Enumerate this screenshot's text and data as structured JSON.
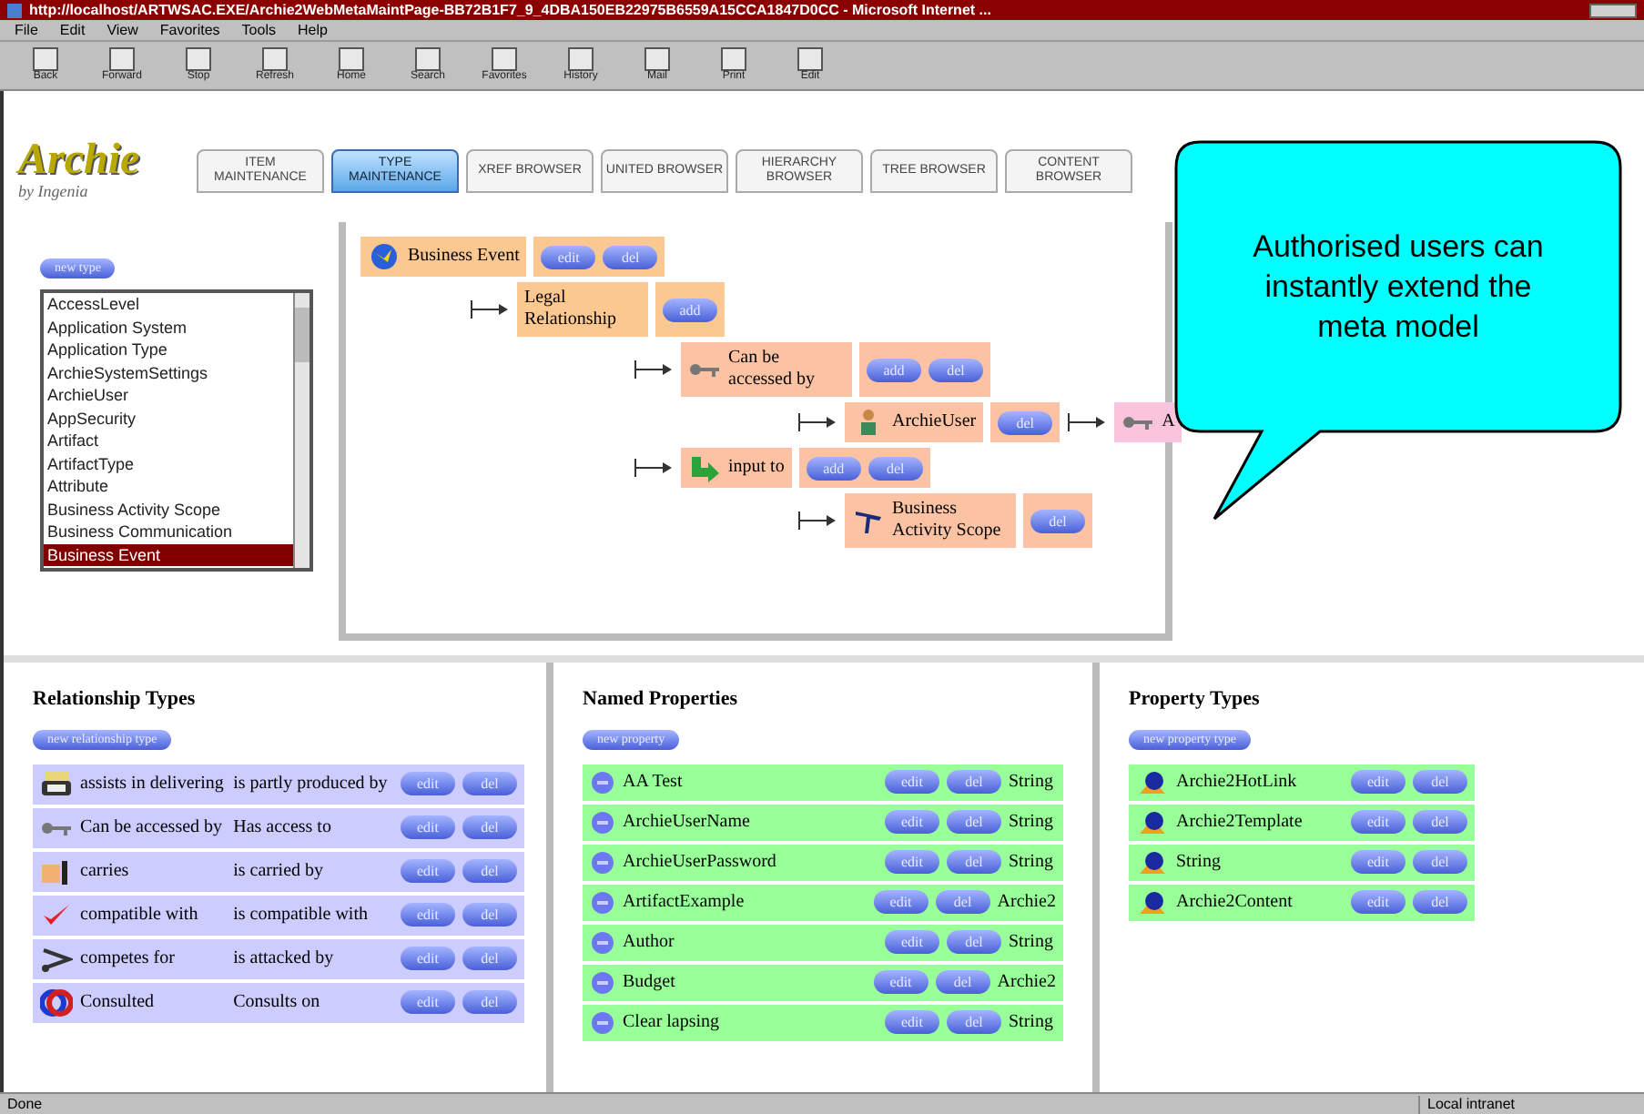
{
  "window": {
    "title": "http://localhost/ARTWSAC.EXE/Archie2WebMetaMaintPage-BB72B1F7_9_4DBA150EB22975B6559A15CCA1847D0CC - Microsoft Internet ..."
  },
  "menu": [
    "File",
    "Edit",
    "View",
    "Favorites",
    "Tools",
    "Help"
  ],
  "toolbar": [
    "Back",
    "Forward",
    "Stop",
    "Refresh",
    "Home",
    "Search",
    "Favorites",
    "History",
    "Mail",
    "Print",
    "Edit"
  ],
  "logo": {
    "name": "Archie",
    "tagline": "by Ingenia"
  },
  "tabs": [
    {
      "label": "ITEM MAINTENANCE",
      "selected": false
    },
    {
      "label": "TYPE MAINTENANCE",
      "selected": true
    },
    {
      "label": "XREF BROWSER",
      "selected": false
    },
    {
      "label": "UNITED BROWSER",
      "selected": false
    },
    {
      "label": "HIERARCHY BROWSER",
      "selected": false
    },
    {
      "label": "TREE BROWSER",
      "selected": false
    },
    {
      "label": "CONTENT BROWSER",
      "selected": false
    }
  ],
  "type_list": {
    "button": "new type",
    "items": [
      {
        "label": "AccessLevel",
        "selected": false
      },
      {
        "label": "Application System",
        "selected": false
      },
      {
        "label": "Application Type",
        "selected": false
      },
      {
        "label": "ArchieSystemSettings",
        "selected": false
      },
      {
        "label": "ArchieUser",
        "selected": false
      },
      {
        "label": "AppSecurity",
        "selected": false
      },
      {
        "label": "Artifact",
        "selected": false
      },
      {
        "label": "ArtifactType",
        "selected": false
      },
      {
        "label": "Attribute",
        "selected": false
      },
      {
        "label": "Business Activity Scope",
        "selected": false
      },
      {
        "label": "Business Communication",
        "selected": false
      },
      {
        "label": "Business Event",
        "selected": true
      }
    ]
  },
  "tree": [
    {
      "label": "Business Event",
      "buttons": [
        "edit",
        "del"
      ],
      "children": [
        {
          "label": "Legal Relationship",
          "buttons": [
            "add"
          ],
          "children": [
            {
              "label": "Can be accessed by",
              "buttons": [
                "add",
                "del"
              ],
              "children": [
                {
                  "label": "ArchieUser",
                  "buttons": [
                    "del"
                  ],
                  "children": [
                    {
                      "label": "A"
                    }
                  ]
                }
              ]
            },
            {
              "label": "input to",
              "buttons": [
                "add",
                "del"
              ],
              "children": [
                {
                  "label": "Business Activity Scope",
                  "buttons": [
                    "del"
                  ]
                }
              ]
            }
          ]
        }
      ]
    }
  ],
  "relationship_types": {
    "title": "Relationship Types",
    "button": "new relationship type",
    "rows": [
      {
        "name": "assists in delivering",
        "inverse": "is partly produced by",
        "buttons": [
          "edit",
          "del"
        ]
      },
      {
        "name": "Can be accessed by",
        "inverse": "Has access to",
        "buttons": [
          "edit",
          "del"
        ]
      },
      {
        "name": "carries",
        "inverse": "is carried by",
        "buttons": [
          "edit",
          "del"
        ]
      },
      {
        "name": "compatible with",
        "inverse": "is compatible with",
        "buttons": [
          "edit",
          "del"
        ]
      },
      {
        "name": "competes for",
        "inverse": "is attacked by",
        "buttons": [
          "edit",
          "del"
        ]
      },
      {
        "name": "Consulted",
        "inverse": "Consults on",
        "buttons": [
          "edit",
          "del"
        ]
      }
    ]
  },
  "named_properties": {
    "title": "Named Properties",
    "button": "new property",
    "rows": [
      {
        "name": "AA Test",
        "buttons": [
          "edit",
          "del"
        ],
        "type": "String"
      },
      {
        "name": "ArchieUserName",
        "buttons": [
          "edit",
          "del"
        ],
        "type": "String"
      },
      {
        "name": "ArchieUserPassword",
        "buttons": [
          "edit",
          "del"
        ],
        "type": "String"
      },
      {
        "name": "ArtifactExample",
        "buttons": [
          "edit",
          "del"
        ],
        "type": "Archie2"
      },
      {
        "name": "Author",
        "buttons": [
          "edit",
          "del"
        ],
        "type": "String"
      },
      {
        "name": "Budget",
        "buttons": [
          "edit",
          "del"
        ],
        "type": "Archie2"
      },
      {
        "name": "Clear lapsing",
        "buttons": [
          "edit",
          "del"
        ],
        "type": "String"
      }
    ]
  },
  "property_types": {
    "title": "Property Types",
    "button": "new property type",
    "rows": [
      {
        "name": "Archie2HotLink",
        "buttons": [
          "edit",
          "del"
        ]
      },
      {
        "name": "Archie2Template",
        "buttons": [
          "edit",
          "del"
        ]
      },
      {
        "name": "String",
        "buttons": [
          "edit",
          "del"
        ]
      },
      {
        "name": "Archie2Content",
        "buttons": [
          "edit",
          "del"
        ]
      }
    ]
  },
  "callout": "Authorised users can instantly extend the meta model",
  "status_bar": {
    "left": "Done",
    "right": "Local intranet"
  }
}
